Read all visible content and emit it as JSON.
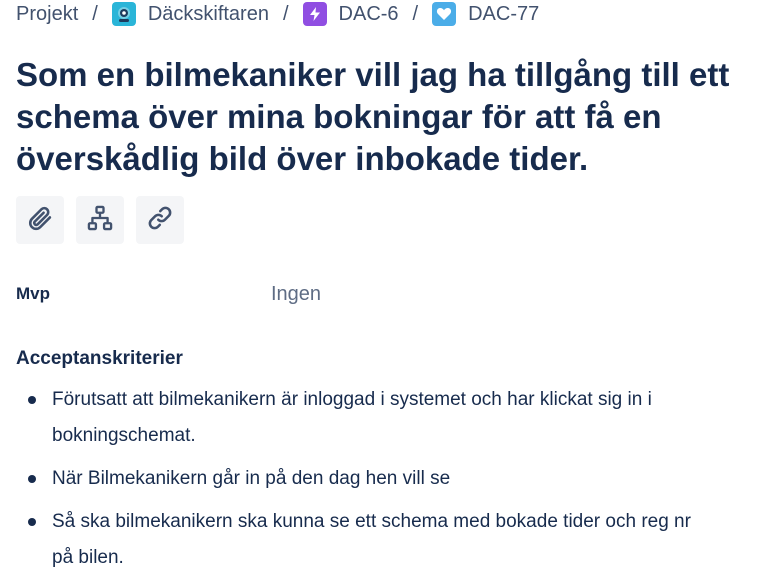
{
  "breadcrumb": {
    "items": [
      {
        "label": "Projekt",
        "icon": ""
      },
      {
        "label": "Däckskiftaren",
        "icon": "project-avatar-icon",
        "icon_color": "#2ab5d8"
      },
      {
        "label": "DAC-6",
        "icon": "epic-lightning-icon",
        "icon_color": "#904ee2"
      },
      {
        "label": "DAC-77",
        "icon": "story-heart-icon",
        "icon_color": "#4bade8"
      }
    ],
    "separator": "/"
  },
  "issue": {
    "title": "Som en bilmekaniker vill jag ha tillgång till ett schema över mina bokningar för att få en överskådlig bild över inbokade tider."
  },
  "toolbar": {
    "buttons": [
      {
        "name": "attach",
        "icon": "paperclip-icon"
      },
      {
        "name": "child-issue",
        "icon": "hierarchy-icon"
      },
      {
        "name": "link-issue",
        "icon": "link-icon"
      }
    ]
  },
  "fields": {
    "mvp": {
      "label": "Mvp",
      "value": "Ingen"
    }
  },
  "acceptance": {
    "heading": "Acceptanskriterier",
    "items": [
      "Förutsatt att bilmekanikern är inloggad i systemet och har klickat sig in i bokningschemat.",
      "När Bilmekanikern går in på den dag hen vill se",
      "Så ska bilmekanikern ska kunna se ett schema med bokade tider och reg nr på bilen."
    ]
  },
  "colors": {
    "text": "#172b4d",
    "muted": "#42526e",
    "button_bg": "#f4f5f7"
  }
}
